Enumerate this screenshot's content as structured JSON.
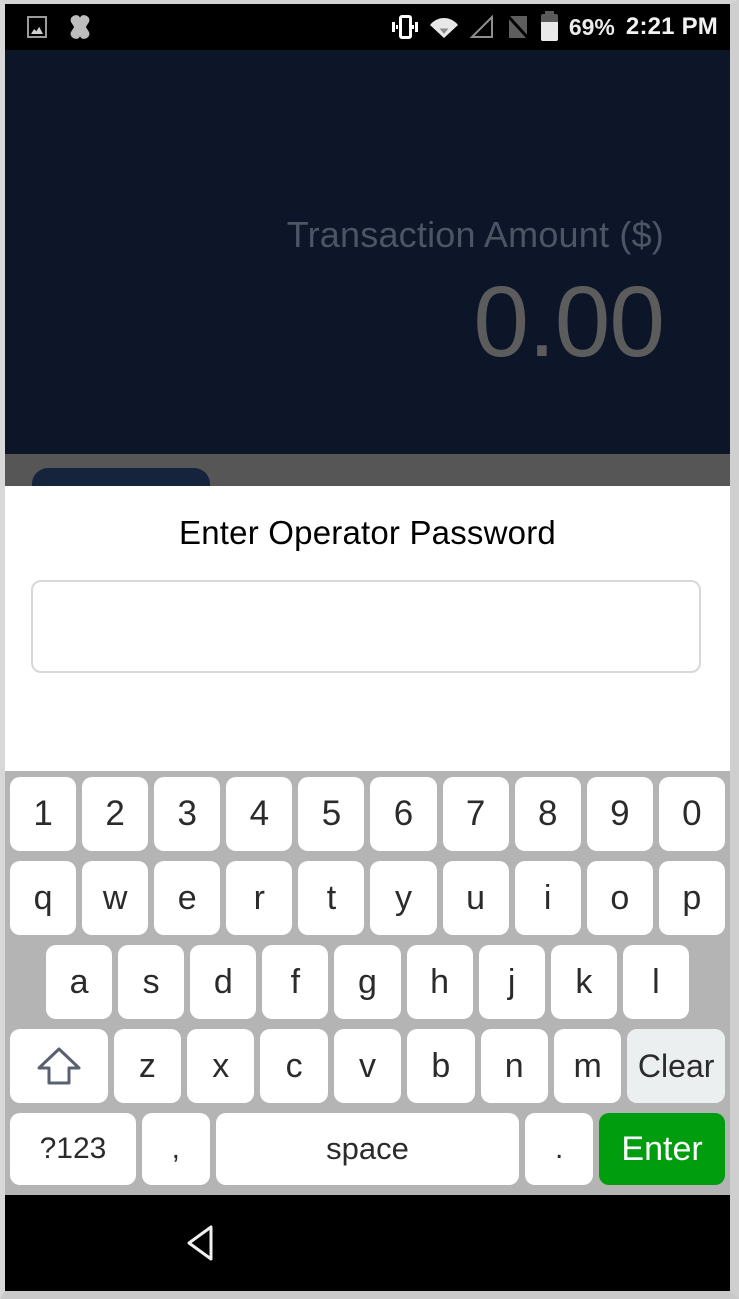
{
  "statusbar": {
    "left_icons": [
      "image-icon",
      "x-shape-icon"
    ],
    "right_icons": [
      "vibrate-icon",
      "wifi-icon",
      "signal-icon",
      "no-sim-icon",
      "battery-icon"
    ],
    "battery_percent": "69%",
    "battery_level": 69,
    "time": "2:21 PM"
  },
  "app": {
    "amount_label": "Transaction Amount ($)",
    "amount_value": "0.00",
    "background_color": "#0c1628",
    "hidden_button_color": "#16233c"
  },
  "dialog": {
    "title": "Enter Operator Password",
    "password_value": "",
    "password_placeholder": ""
  },
  "keyboard": {
    "row_numbers": [
      "1",
      "2",
      "3",
      "4",
      "5",
      "6",
      "7",
      "8",
      "9",
      "0"
    ],
    "row_qwerty": [
      "q",
      "w",
      "e",
      "r",
      "t",
      "y",
      "u",
      "i",
      "o",
      "p"
    ],
    "row_asdf": [
      "a",
      "s",
      "d",
      "f",
      "g",
      "h",
      "j",
      "k",
      "l"
    ],
    "row_zxcv": [
      "z",
      "x",
      "c",
      "v",
      "b",
      "n",
      "m"
    ],
    "shift_label": "shift",
    "clear_label": "Clear",
    "symbols_label": "?123",
    "comma_label": ",",
    "space_label": "space",
    "period_label": ".",
    "enter_label": "Enter",
    "enter_color": "#009e0f",
    "background_color": "#b4b4b4"
  },
  "navbar": {
    "back_label": "back"
  }
}
